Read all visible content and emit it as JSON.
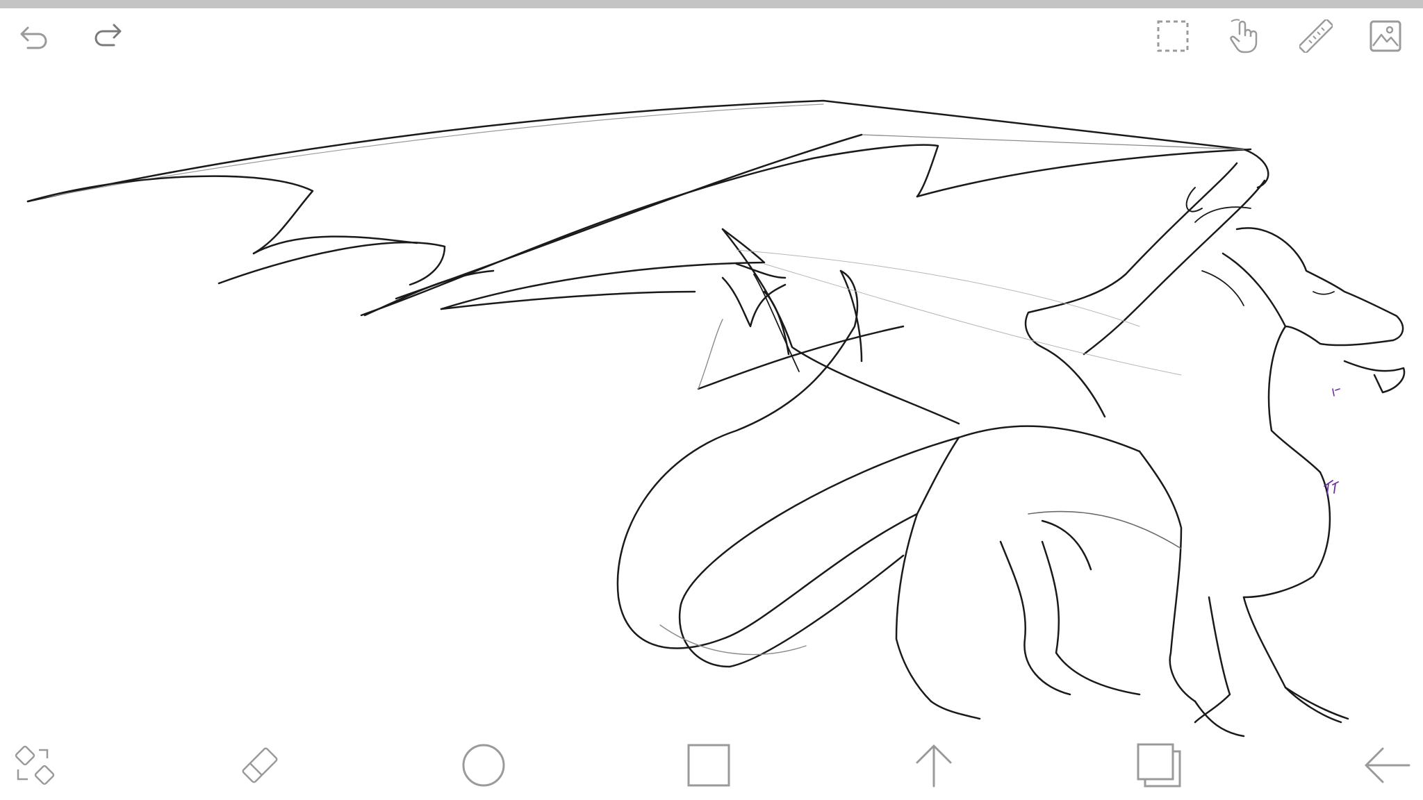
{
  "app": {
    "name": "Sketch canvas",
    "accent_color": "#9a9a9a",
    "stroke_color": "#1a1a1a",
    "signature_color": "#6b2fa0"
  },
  "top_toolbar": {
    "left": [
      {
        "id": "undo",
        "icon": "undo-icon"
      },
      {
        "id": "redo",
        "icon": "redo-icon"
      }
    ],
    "right": [
      {
        "id": "select",
        "icon": "marquee-select-icon"
      },
      {
        "id": "touch",
        "icon": "hand-touch-icon"
      },
      {
        "id": "ruler",
        "icon": "ruler-icon"
      },
      {
        "id": "image",
        "icon": "image-icon"
      }
    ]
  },
  "bottom_toolbar": [
    {
      "id": "transform",
      "icon": "transform-icon"
    },
    {
      "id": "eraser",
      "icon": "eraser-icon"
    },
    {
      "id": "ellipse",
      "icon": "circle-icon"
    },
    {
      "id": "rectangle",
      "icon": "square-icon"
    },
    {
      "id": "arrow-up",
      "icon": "arrow-up-icon"
    },
    {
      "id": "layers",
      "icon": "layers-icon"
    },
    {
      "id": "back",
      "icon": "arrow-left-icon"
    }
  ],
  "canvas": {
    "subject": "dragon-line-art"
  }
}
